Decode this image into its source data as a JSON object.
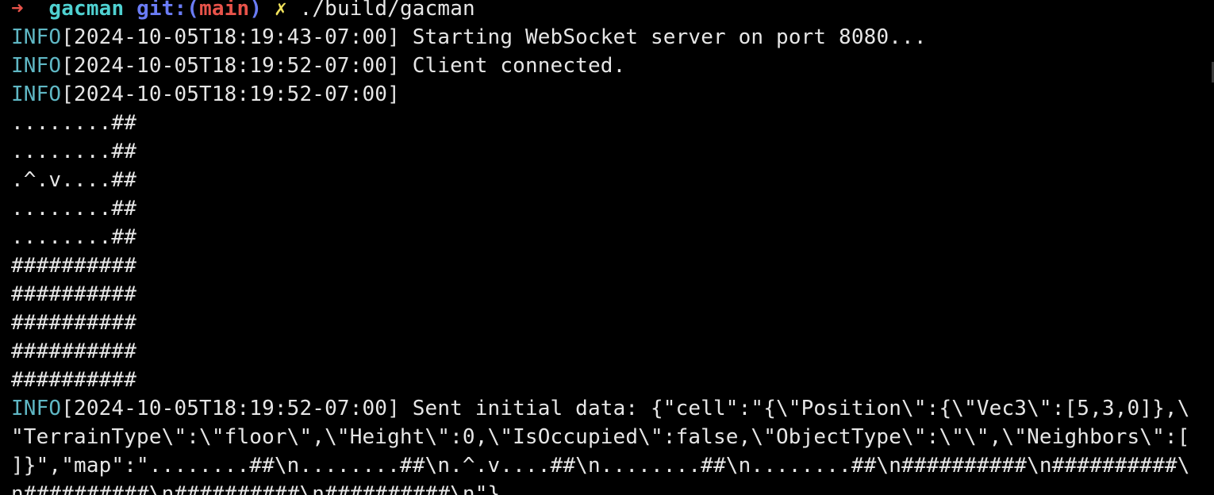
{
  "prompt": {
    "arrow": "➜",
    "directory": "gacman",
    "git_label": "git:(",
    "branch": "main",
    "git_close": ")",
    "dirty_mark": "✗",
    "command": "./build/gacman"
  },
  "log": [
    {
      "level": "INFO",
      "time": "[2024-10-05T18:19:43-07:00]",
      "message": " Starting WebSocket server on port 8080..."
    },
    {
      "level": "INFO",
      "time": "[2024-10-05T18:19:52-07:00]",
      "message": " Client connected."
    },
    {
      "level": "INFO",
      "time": "[2024-10-05T18:19:52-07:00]",
      "message": ""
    }
  ],
  "map_rows": [
    "........##",
    "........##",
    ".^.v....##",
    "........##",
    "........##",
    "##########",
    "##########",
    "##########",
    "##########",
    "##########"
  ],
  "final_log": {
    "level": "INFO",
    "time": "[2024-10-05T18:19:52-07:00]",
    "message": " Sent initial data: {\"cell\":\"{\\\"Position\\\":{\\\"Vec3\\\":[5,3,0]},\\",
    "continuation": [
      "\"TerrainType\\\":\\\"floor\\\",\\\"Height\\\":0,\\\"IsOccupied\\\":false,\\\"ObjectType\\\":\\\"\\\",\\\"Neighbors\\\":[",
      "]}\",\"map\":\"........##\\n........##\\n.^.v....##\\n........##\\n........##\\n##########\\n##########\\",
      "n##########\\n##########\\n##########\\n\"}"
    ]
  },
  "colors": {
    "background": "#000000",
    "text": "#e6e6e6",
    "info": "#5fb7c4",
    "prompt_arrow": "#e8534a",
    "prompt_dir": "#4fd1d1",
    "prompt_git": "#6a7cf5",
    "prompt_dirty": "#f2e35c"
  }
}
